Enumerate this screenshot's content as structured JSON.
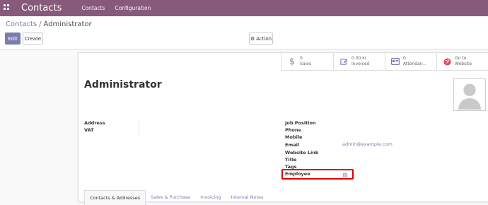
{
  "topbar": {
    "brand": "Contacts",
    "menu": [
      "Contacts",
      "Configuration"
    ]
  },
  "breadcrumb": {
    "parent": "Contacts",
    "separator": "/",
    "current": "Administrator"
  },
  "buttons": {
    "edit": "Edit",
    "create": "Create",
    "action": "Action"
  },
  "stat_buttons": [
    {
      "icon": "dollar-icon",
      "value": "0",
      "label": "Sales"
    },
    {
      "icon": "pencil-square-icon",
      "value": "0.00 kr",
      "label": "Invoiced"
    },
    {
      "icon": "id-card-icon",
      "value": "0",
      "label": "Attendan..."
    },
    {
      "icon": "globe-icon",
      "value": "Go to",
      "label": "Website"
    }
  ],
  "form": {
    "title": "Administrator",
    "left_labels": {
      "address": "Address",
      "vat": "VAT"
    },
    "right_labels": {
      "job_position": "Job Position",
      "phone": "Phone",
      "mobile": "Mobile",
      "email": "Email",
      "website_link": "Website Link",
      "title": "Title",
      "tags": "Tags",
      "employee": "Employee"
    },
    "email_value": "admin@example.com",
    "employee_checked": true
  },
  "tabs": [
    "Contacts & Addresses",
    "Sales & Purchase",
    "Invoicing",
    "Internal Notes"
  ],
  "colors": {
    "brand": "#875a7b",
    "accent": "#7c7bad",
    "highlight": "#e00000"
  }
}
